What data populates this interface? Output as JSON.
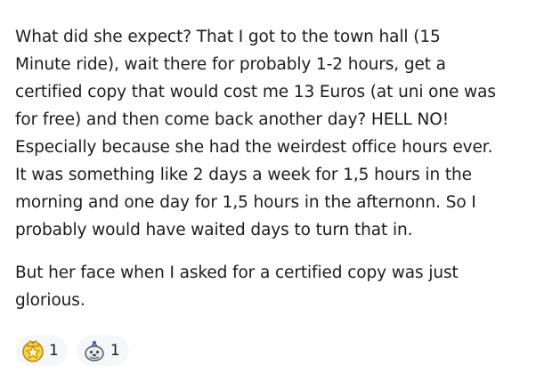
{
  "comment": {
    "paragraphs": [
      "What did she expect? That I got to the town hall (15\nMinute ride), wait there for probably 1-2 hours, get a\ncertified copy that would cost me 13 Euros (at uni one was\nfor free) and then come back another day? HELL NO!\nEspecially because she had the weirdest office hours ever.\nIt was something like 2 days a week for 1,5 hours in the\nmorning and one day for 1,5 hours in the afternonn. So I\nprobably would have waited days to turn that in.",
      "But her face when I asked for a certified copy was just\nglorious."
    ]
  },
  "awards": [
    {
      "icon": "gold-award-icon",
      "count": "1",
      "color": "#f5c518"
    },
    {
      "icon": "wholesome-seal-icon",
      "count": "1",
      "color": "#b9c6d3"
    }
  ]
}
